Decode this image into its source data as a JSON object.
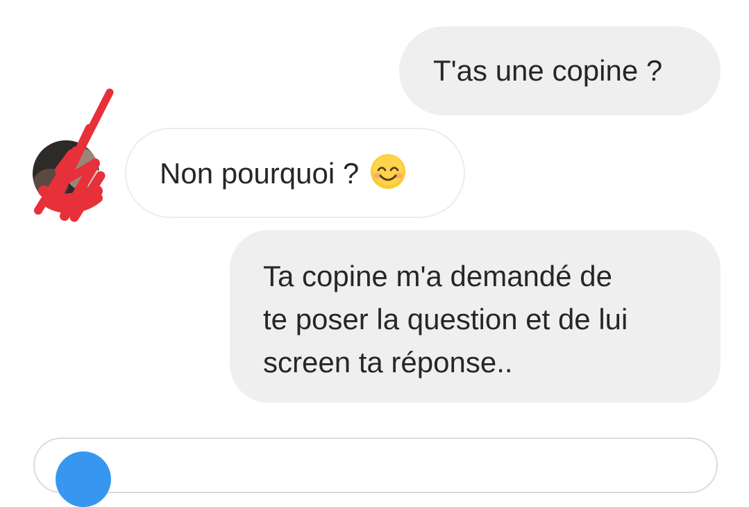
{
  "thread": {
    "messages": [
      {
        "direction": "sent",
        "text": "T'as une copine ?"
      },
      {
        "direction": "received",
        "text": "Non pourquoi ?",
        "emoji": "smiling-face-with-smiling-eyes-icon"
      },
      {
        "direction": "sent",
        "text": "Ta copine m'a demandé de\nte poser la question et de lui\nscreen ta réponse.."
      }
    ],
    "avatar": {
      "redacted": true,
      "redaction_color": "#e8303a"
    }
  },
  "composer": {
    "camera_icon": "camera-icon",
    "accent": "#3797f0"
  },
  "colors": {
    "sent_bubble": "#efefef",
    "received_border": "#ececec",
    "text": "#262626"
  }
}
